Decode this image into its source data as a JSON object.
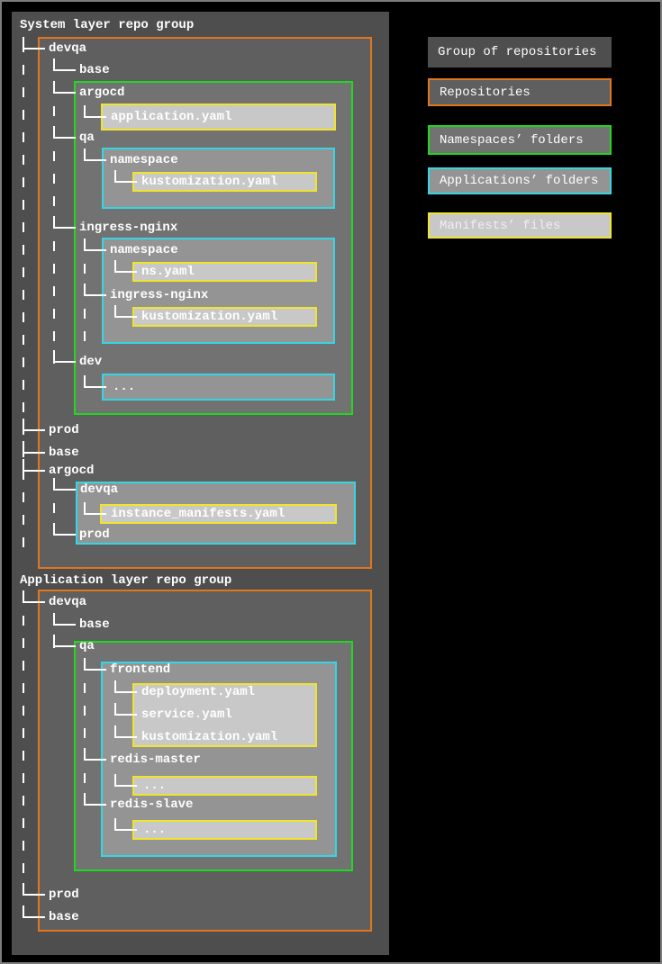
{
  "colors": {
    "background": "#000000",
    "group_of_repositories_fill": "#4e4e4e",
    "repositories_fill": "#5f5f5f",
    "repositories_border": "#e0761e",
    "namespaces_folders_fill": "#727272",
    "namespaces_folders_border": "#21d721",
    "applications_folders_fill": "#949494",
    "applications_folders_border": "#35d6e4",
    "manifests_files_fill": "#c8c8c8",
    "manifests_files_border": "#f0e42c",
    "tree_lines": "#ffffff",
    "text": "#ffffff"
  },
  "system_group": {
    "title": "System layer repo group",
    "rows": [
      "devqa",
      "base",
      "argocd",
      "application.yaml",
      "qa",
      "namespace",
      "kustomization.yaml",
      "ingress-nginx",
      "namespace",
      "ns.yaml",
      "ingress-nginx",
      "kustomization.yaml",
      "dev",
      "...",
      "prod",
      "base",
      "argocd",
      "devqa",
      "instance_manifests.yaml",
      "prod"
    ]
  },
  "application_group": {
    "title": "Application layer repo group",
    "rows": [
      "devqa",
      "base",
      "qa",
      "frontend",
      "deployment.yaml",
      "service.yaml",
      "kustomization.yaml",
      "redis-master",
      "...",
      "redis-slave",
      "...",
      "prod",
      "base"
    ]
  },
  "legend": {
    "items": [
      {
        "label": "Group of repositories",
        "type": "group-of-repositories"
      },
      {
        "label": "Repositories",
        "type": "repositories"
      },
      {
        "label": "Namespaces’ folders",
        "type": "namespaces-folders"
      },
      {
        "label": "Applications’ folders",
        "type": "applications-folders"
      },
      {
        "label": "Manifests’ files",
        "type": "manifests-files"
      }
    ]
  }
}
